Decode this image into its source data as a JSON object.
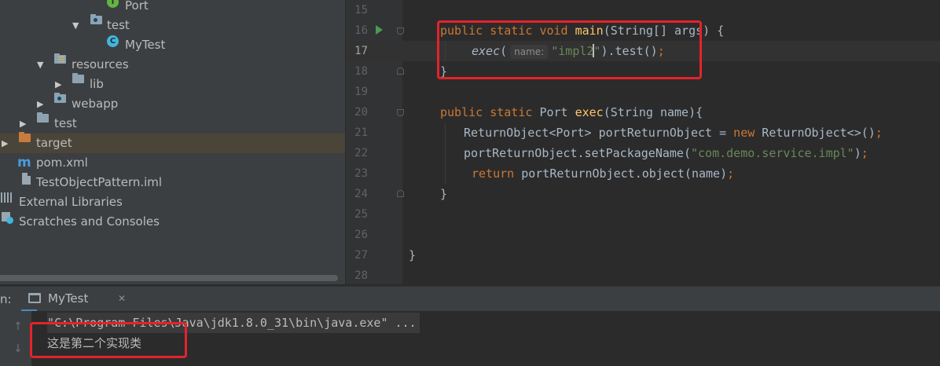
{
  "tree": {
    "items": [
      {
        "label": "Port",
        "icon": "interface-icon"
      },
      {
        "label": "test",
        "icon": "package-folder-icon"
      },
      {
        "label": "MyTest",
        "icon": "class-icon"
      },
      {
        "label": "resources",
        "icon": "resources-folder-icon"
      },
      {
        "label": "lib",
        "icon": "folder-icon"
      },
      {
        "label": "webapp",
        "icon": "web-folder-icon"
      },
      {
        "label": "test",
        "icon": "folder-icon"
      },
      {
        "label": "target",
        "icon": "excluded-folder-icon",
        "selected": true
      },
      {
        "label": "pom.xml",
        "icon": "maven-icon"
      },
      {
        "label": "TestObjectPattern.iml",
        "icon": "iml-file-icon"
      },
      {
        "label": "External Libraries",
        "icon": "libraries-icon"
      },
      {
        "label": "Scratches and Consoles",
        "icon": "scratches-icon"
      }
    ],
    "icon_letters": {
      "interface": "I",
      "class": "C",
      "maven": "m"
    }
  },
  "editor": {
    "line_numbers": [
      "15",
      "16",
      "17",
      "18",
      "19",
      "20",
      "21",
      "22",
      "23",
      "24",
      "25",
      "26",
      "27",
      "28"
    ],
    "current_line": "17",
    "param_hint": "name:"
  },
  "code_tokens": {
    "l16": [
      "public",
      "static",
      "void",
      "main",
      "(String[] args) {"
    ],
    "l17": [
      "exec",
      "(",
      "\"impl2",
      "\"",
      ").test()",
      ";"
    ],
    "l18": [
      "}"
    ],
    "l20": [
      "public",
      "static",
      "Port",
      "exec",
      "(String name){"
    ],
    "l21": [
      "ReturnObject<Port> portReturnObject = ",
      "new",
      "ReturnObject<>()",
      ";"
    ],
    "l22": [
      "portReturnObject.setPackageName(",
      "\"com.demo.service.impl\"",
      ")",
      ";"
    ],
    "l23": [
      "return",
      "portReturnObject.object(name)",
      ";"
    ],
    "l24": [
      "}"
    ],
    "l27": [
      "}"
    ]
  },
  "run_panel": {
    "label": "n:",
    "tab_label": "MyTest",
    "tab_close": "✕",
    "command_line": "\"C:\\Program Files\\Java\\jdk1.8.0_31\\bin\\java.exe\" ...",
    "output": "这是第二个实现类",
    "up_arrow": "↑",
    "down_arrow": "↓"
  },
  "colors": {
    "annotation": "#e4232b",
    "keyword": "#cc7832",
    "function": "#ffc66d",
    "string": "#6a8759",
    "plain": "#a9b7c6"
  }
}
